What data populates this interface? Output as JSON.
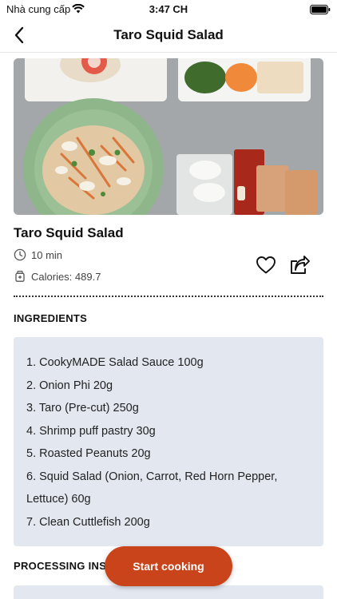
{
  "status_bar": {
    "carrier": "Nhà cung cấp",
    "time": "3:47 CH"
  },
  "nav": {
    "title": "Taro Squid Salad"
  },
  "recipe": {
    "name": "Taro Squid Salad",
    "time": "10 min",
    "calories": "Calories: 489.7"
  },
  "ingredients": {
    "heading": "INGREDIENTS",
    "items": [
      "1. CookyMADE Salad Sauce 100g",
      "2. Onion Phi 20g",
      "3. Taro (Pre-cut) 250g",
      "4. Shrimp puff pastry 30g",
      "5. Roasted Peanuts 20g",
      "6. Squid Salad (Onion, Carrot, Red Horn Pepper, Lettuce) 60g",
      "7. Clean Cuttlefish 200g"
    ]
  },
  "processing": {
    "heading": "PROCESSING INS"
  },
  "actions": {
    "start_cooking": "Start cooking"
  },
  "colors": {
    "accent": "#c9441a",
    "panel": "#e3e8f0"
  }
}
